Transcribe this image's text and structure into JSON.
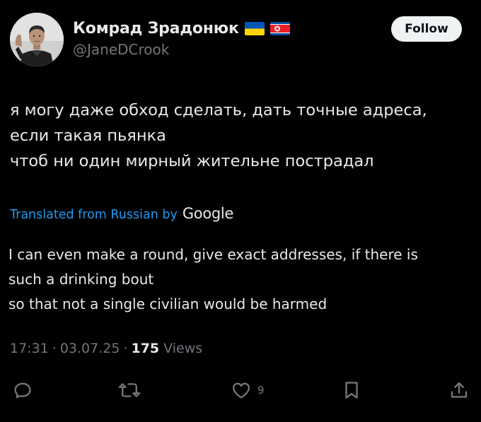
{
  "author": {
    "display_name": "Комрад Зрадонюк",
    "handle": "@JaneDCrook",
    "avatar": "profile-photo",
    "flags": [
      "ukraine-flag-icon",
      "north-korea-flag-icon"
    ]
  },
  "follow_button": {
    "label": "Follow"
  },
  "tweet": {
    "original_lines": [
      "я могу даже обход сделать, дать точные адреса,",
      "если такая пьянка",
      "чтоб ни один мирный жительне пострадал"
    ],
    "translation": {
      "label": "Translated from Russian by",
      "provider": "Google",
      "lines": [
        "I can even make a round, give exact addresses, if there is",
        "such a drinking bout",
        "so that not a single civilian would be harmed"
      ]
    },
    "time": "17:31",
    "date": "03.07.25",
    "separator": "·",
    "views_count": "175",
    "views_label": "Views"
  },
  "actions": {
    "reply_icon": "reply-icon",
    "retweet_icon": "retweet-icon",
    "like_icon": "heart-icon",
    "like_count": "9",
    "bookmark_icon": "bookmark-icon",
    "share_icon": "share-icon"
  },
  "colors": {
    "background": "#000000",
    "text_primary": "#e7e9ea",
    "text_secondary": "#71767b",
    "link": "#1d9bf0",
    "button_bg": "#eff3f4",
    "button_text": "#0f1419"
  }
}
